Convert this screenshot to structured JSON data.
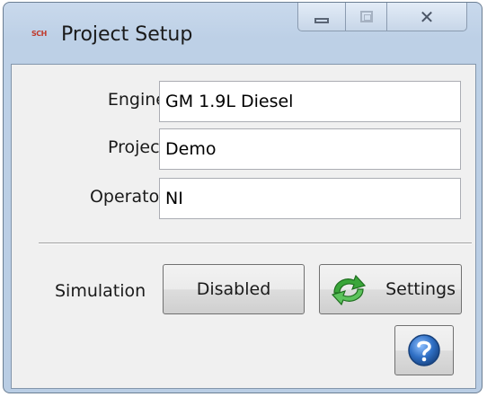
{
  "window": {
    "title": "Project Setup",
    "logo_text": "SCH",
    "close_glyph": "✕"
  },
  "fields": {
    "engine": {
      "label": "Engine",
      "value": "GM 1.9L Diesel"
    },
    "project": {
      "label": "Project",
      "value": "Demo"
    },
    "operator": {
      "label": "Operator",
      "value": "NI"
    }
  },
  "simulation": {
    "label": "Simulation",
    "toggle_label": "Disabled",
    "settings_label": "Settings",
    "settings_icon": "green-refresh-arrow-icon",
    "help_icon": "question-mark-icon"
  },
  "colors": {
    "titlebar": "#c9d9ec",
    "client_bg": "#f0f0f0",
    "settings_arrow": "#3aa63a",
    "help_blue": "#2f6fc4"
  }
}
